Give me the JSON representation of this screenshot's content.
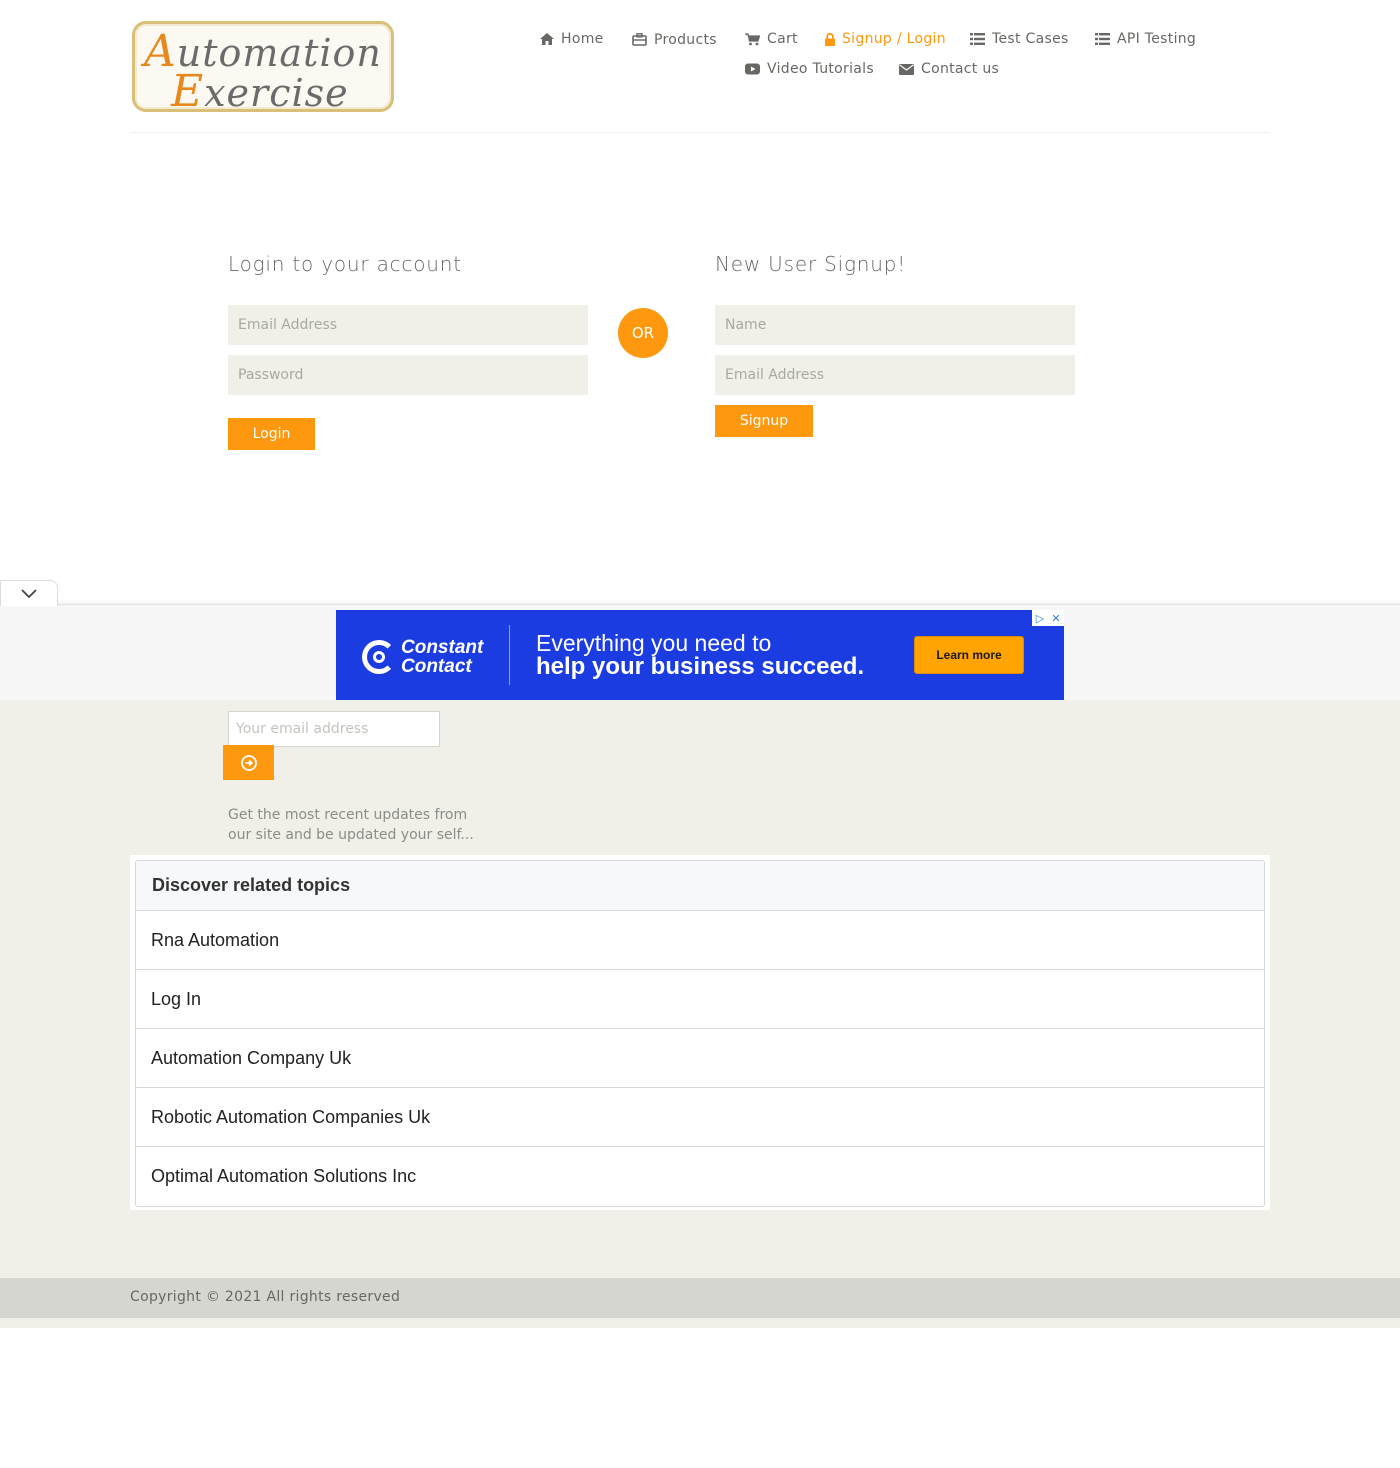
{
  "logo": {
    "cap1": "A",
    "rest1": "utomation",
    "cap2": "E",
    "rest2": "xercise"
  },
  "nav": {
    "home": "Home",
    "products": "Products",
    "cart": "Cart",
    "signup_login": "Signup / Login",
    "test_cases": "Test Cases",
    "api_testing": "API Testing",
    "video_tutorials": "Video Tutorials",
    "contact_us": "Contact us",
    "active_item": "signup_login"
  },
  "login": {
    "title": "Login to your account",
    "email_placeholder": "Email Address",
    "password_placeholder": "Password",
    "button": "Login"
  },
  "or_label": "OR",
  "signup": {
    "title": "New User Signup!",
    "name_placeholder": "Name",
    "email_placeholder": "Email Address",
    "button": "Signup"
  },
  "ad": {
    "brand_line1": "Constant",
    "brand_line2": "Contact",
    "headline1": "Everything you need to",
    "headline2": "help your business succeed.",
    "cta": "Learn more"
  },
  "subscription": {
    "email_placeholder": "Your email address",
    "text": "Get the most recent updates from our site and be updated your self..."
  },
  "related": {
    "heading": "Discover related topics",
    "items": [
      "Rna Automation",
      "Log In",
      "Automation Company Uk",
      "Robotic Automation Companies Uk",
      "Optimal Automation Solutions Inc"
    ]
  },
  "footer": {
    "copyright": "Copyright © 2021 All rights reserved"
  },
  "colors": {
    "accent": "#fe980f",
    "form_bg": "#f0f0e9",
    "ad_bg": "#1b3ce0",
    "footer_bg": "#d6d6d0"
  },
  "icons": {
    "home": "home-icon",
    "products": "briefcase-icon",
    "cart": "cart-icon",
    "lock": "lock-icon",
    "list": "list-icon",
    "youtube": "youtube-icon",
    "envelope": "envelope-icon",
    "subscribe": "arrow-circle-right-icon",
    "collapse": "chevron-down-icon"
  }
}
